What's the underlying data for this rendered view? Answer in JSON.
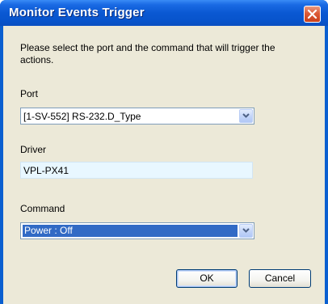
{
  "window": {
    "title": "Monitor Events Trigger"
  },
  "prompt": {
    "text": "Please select the port and the command that will trigger the actions."
  },
  "port": {
    "label": "Port",
    "value": "[1-SV-552] RS-232.D_Type"
  },
  "driver": {
    "label": "Driver",
    "value": "VPL-PX41"
  },
  "command": {
    "label": "Command",
    "value": "Power : Off"
  },
  "buttons": {
    "ok_label": "OK",
    "cancel_label": "Cancel"
  },
  "icons": {
    "close": "close-icon",
    "dropdown": "chevron-down-icon"
  },
  "colors": {
    "titlebar": "#0a58d2",
    "client_bg": "#ece9d8",
    "selection": "#316ac5",
    "readonly_bg": "#e8f7ff"
  }
}
